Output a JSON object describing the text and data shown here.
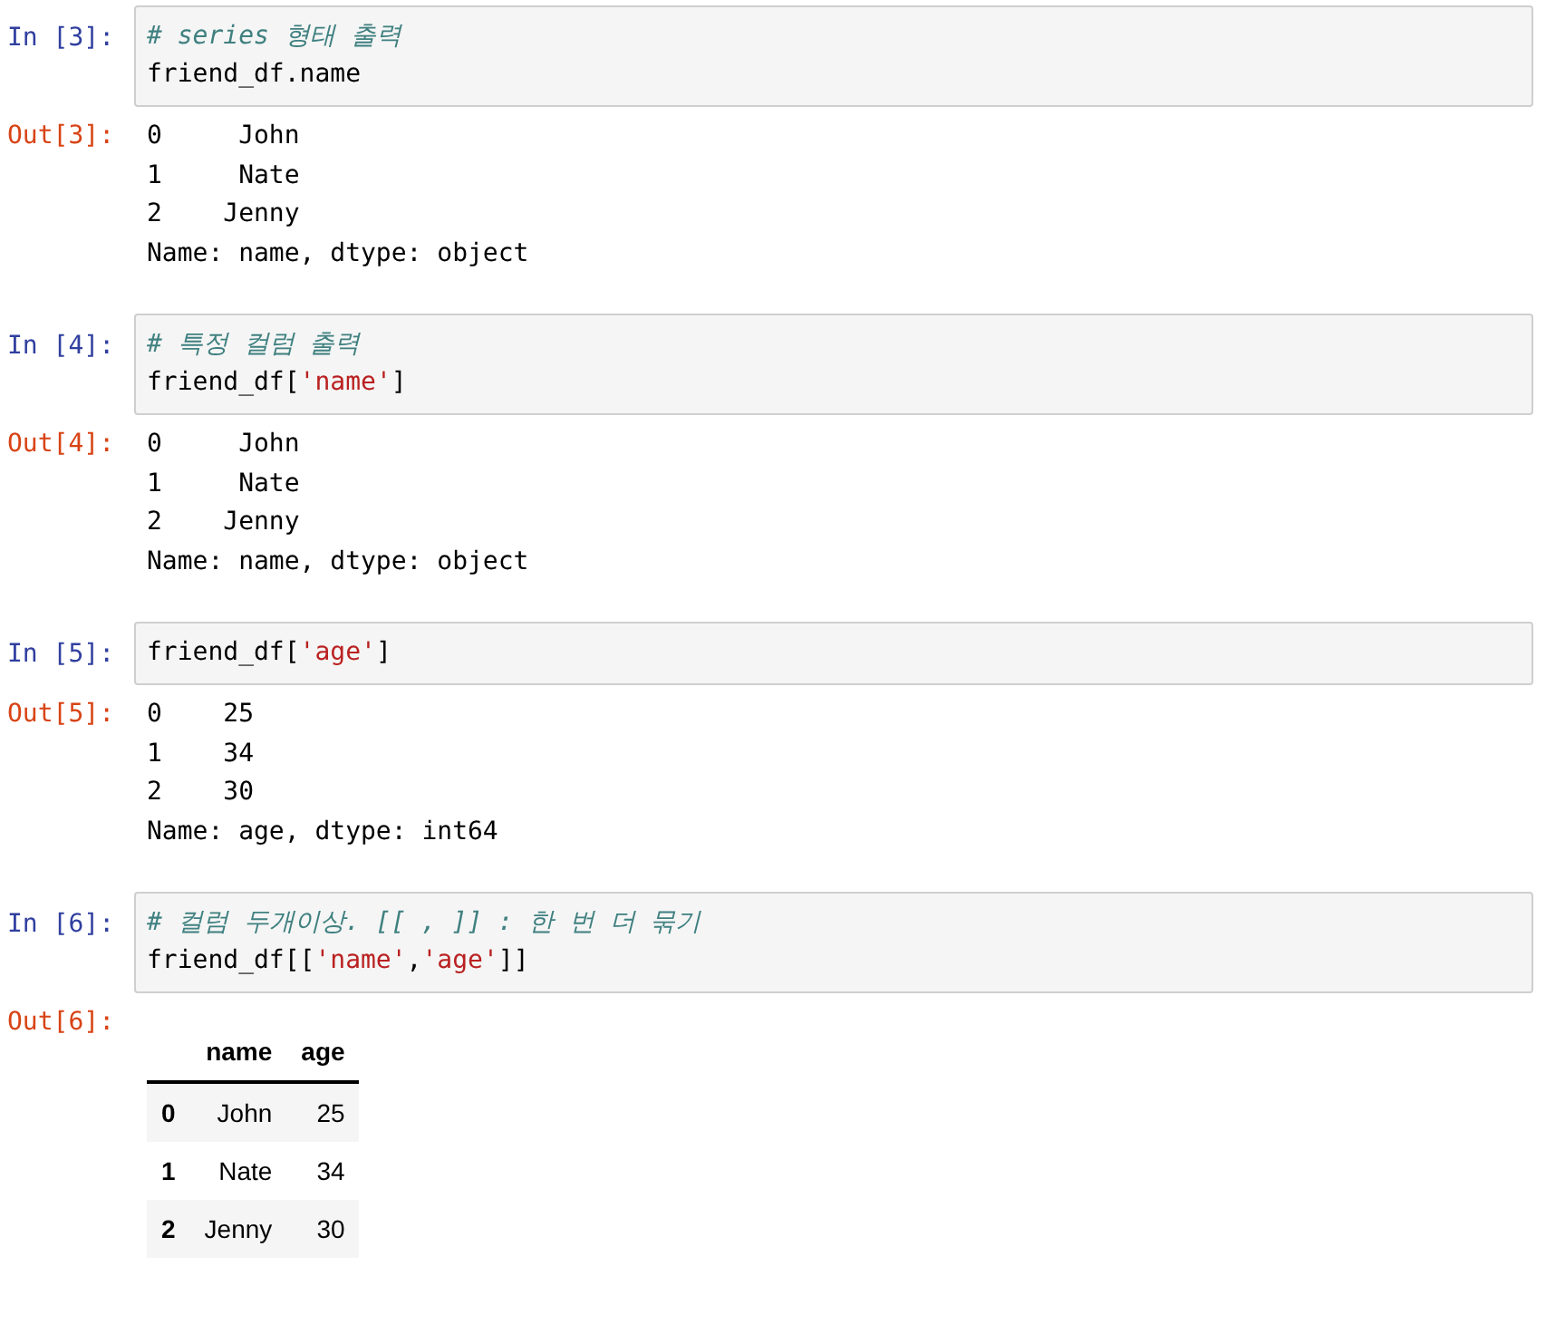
{
  "cells": [
    {
      "in_prompt": "In [3]:",
      "code": [
        [
          {
            "kind": "comment",
            "text": "# series 형태 출력"
          }
        ],
        [
          {
            "kind": "plain",
            "text": "friend_df.name"
          }
        ]
      ],
      "out_prompt": "Out[3]:",
      "output": {
        "kind": "text",
        "lines": [
          "0     John",
          "1     Nate",
          "2    Jenny",
          "Name: name, dtype: object"
        ]
      }
    },
    {
      "in_prompt": "In [4]:",
      "code": [
        [
          {
            "kind": "comment",
            "text": "# 특정 컬럼 출력"
          }
        ],
        [
          {
            "kind": "plain",
            "text": "friend_df["
          },
          {
            "kind": "string",
            "text": "'name'"
          },
          {
            "kind": "plain",
            "text": "]"
          }
        ]
      ],
      "out_prompt": "Out[4]:",
      "output": {
        "kind": "text",
        "lines": [
          "0     John",
          "1     Nate",
          "2    Jenny",
          "Name: name, dtype: object"
        ]
      }
    },
    {
      "in_prompt": "In [5]:",
      "code": [
        [
          {
            "kind": "plain",
            "text": "friend_df["
          },
          {
            "kind": "string",
            "text": "'age'"
          },
          {
            "kind": "plain",
            "text": "]"
          }
        ]
      ],
      "out_prompt": "Out[5]:",
      "output": {
        "kind": "text",
        "lines": [
          "0    25",
          "1    34",
          "2    30",
          "Name: age, dtype: int64"
        ]
      }
    },
    {
      "in_prompt": "In [6]:",
      "code": [
        [
          {
            "kind": "comment",
            "text": "# 컬럼 두개이상. [[ , ]] : 한 번 더 묶기"
          }
        ],
        [
          {
            "kind": "plain",
            "text": "friend_df[["
          },
          {
            "kind": "string",
            "text": "'name'"
          },
          {
            "kind": "plain",
            "text": ","
          },
          {
            "kind": "string",
            "text": "'age'"
          },
          {
            "kind": "plain",
            "text": "]]"
          }
        ]
      ],
      "out_prompt": "Out[6]:",
      "output": {
        "kind": "table",
        "columns": [
          "name",
          "age"
        ],
        "rows": [
          {
            "index": "0",
            "cells": [
              "John",
              "25"
            ]
          },
          {
            "index": "1",
            "cells": [
              "Nate",
              "34"
            ]
          },
          {
            "index": "2",
            "cells": [
              "Jenny",
              "30"
            ]
          }
        ]
      }
    }
  ]
}
